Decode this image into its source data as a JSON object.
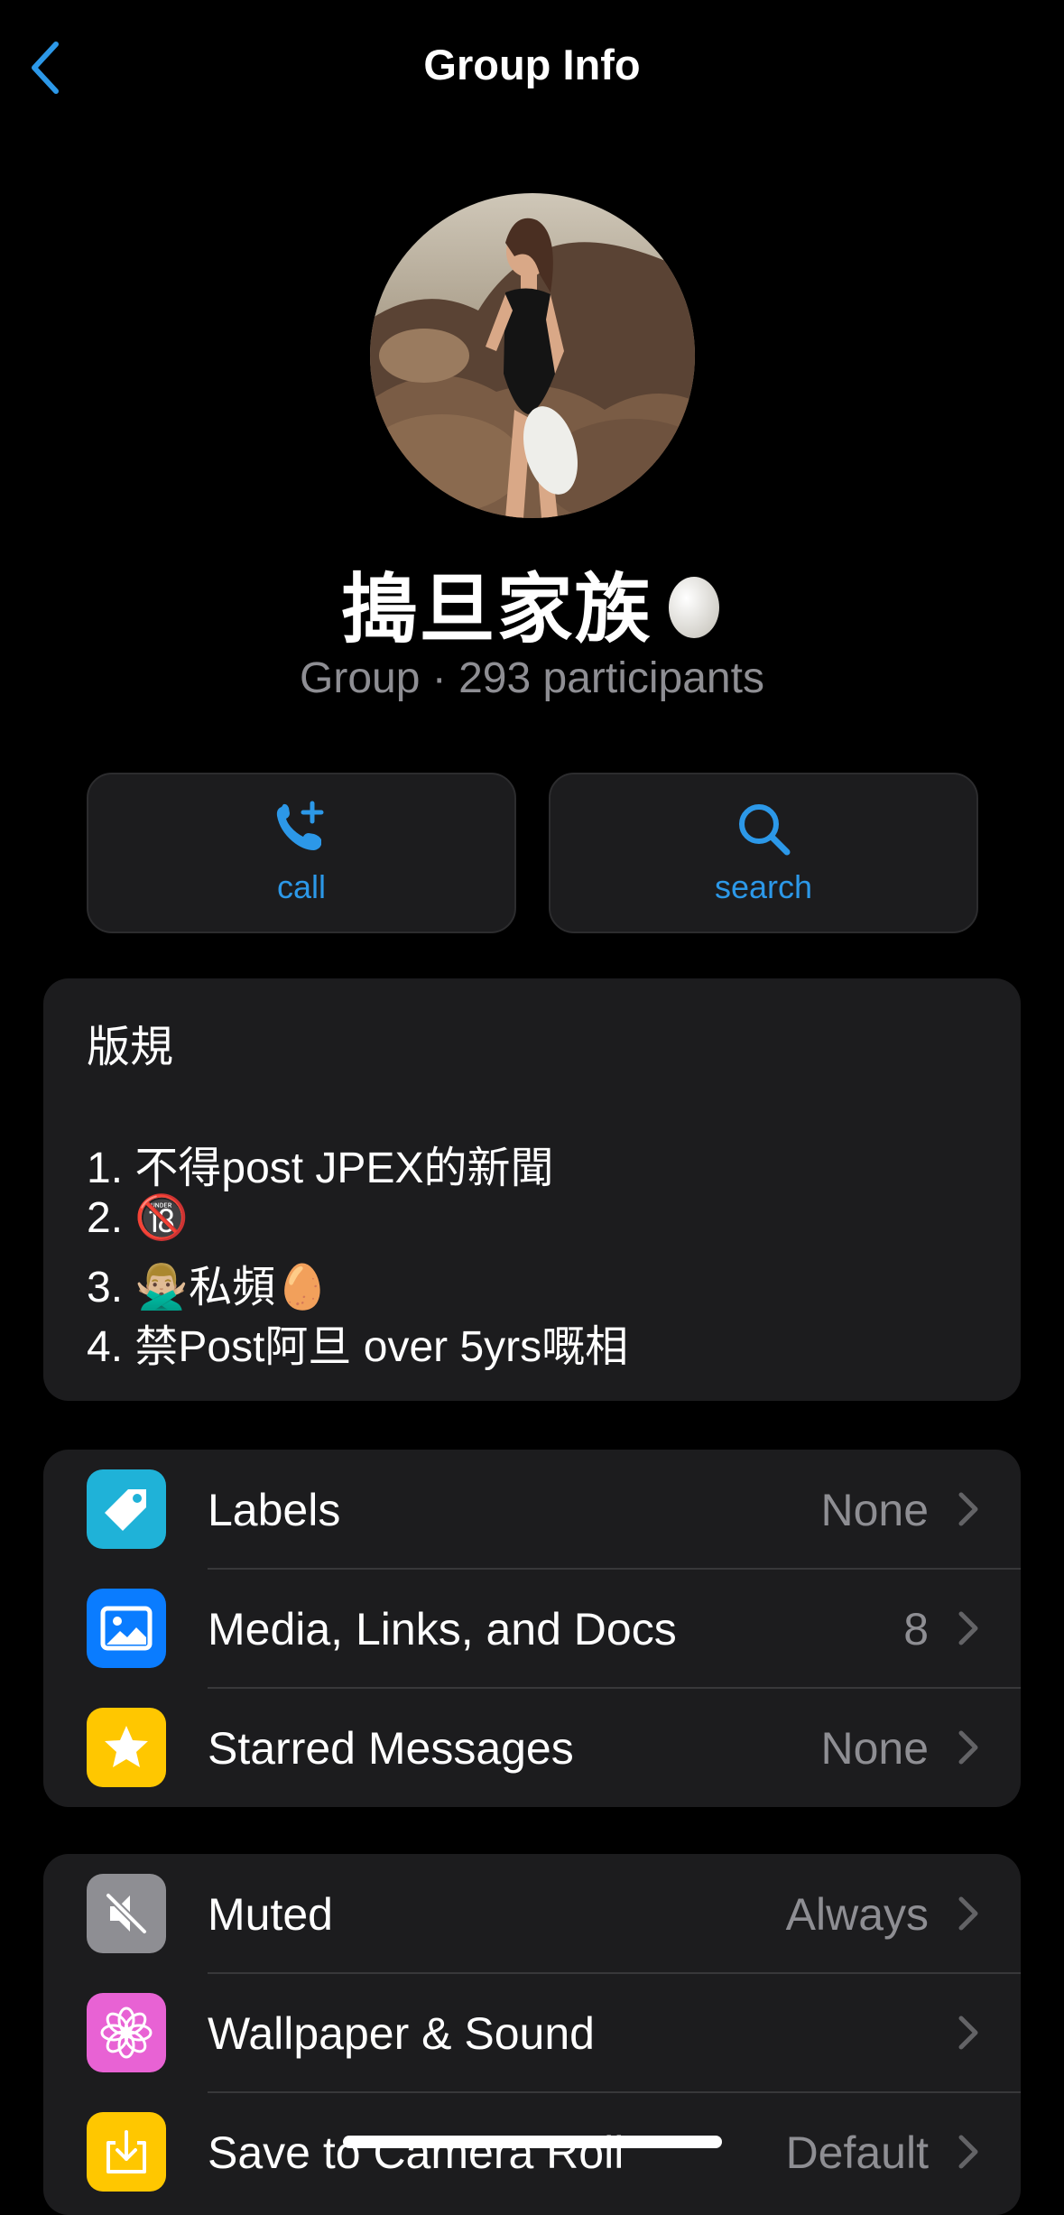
{
  "nav": {
    "title": "Group Info"
  },
  "group": {
    "name": "搗旦家族",
    "subtitle": "Group · 293 participants"
  },
  "actions": [
    {
      "label": "call",
      "icon": "phone-plus-icon"
    },
    {
      "label": "search",
      "icon": "search-icon"
    }
  ],
  "description": {
    "heading": "版規",
    "lines": [
      "1. 不得post JPEX的新聞",
      "2. 🔞",
      "3. 🙅🏼‍♂️私頻🥚",
      "4. 禁Post阿旦 over 5yrs嘅相"
    ]
  },
  "section1": [
    {
      "title": "Labels",
      "value": "None",
      "icon": "tag-icon",
      "color": "#1fb2d8"
    },
    {
      "title": "Media, Links, and Docs",
      "value": "8",
      "icon": "photo-icon",
      "color": "#0a7cff"
    },
    {
      "title": "Starred Messages",
      "value": "None",
      "icon": "star-icon",
      "color": "#ffc700"
    }
  ],
  "section2": [
    {
      "title": "Muted",
      "value": "Always",
      "icon": "muted-speaker-icon",
      "color": "#8e8e93"
    },
    {
      "title": "Wallpaper & Sound",
      "value": "",
      "icon": "flower-icon",
      "color": "#e862d4"
    },
    {
      "title": "Save to Camera Roll",
      "value": "Default",
      "icon": "save-download-icon",
      "color": "#ffc700"
    }
  ],
  "colors": {
    "accent": "#2c98e8",
    "background": "#000000",
    "card": "#1c1c1e",
    "secondary_text": "#8e8e93"
  }
}
